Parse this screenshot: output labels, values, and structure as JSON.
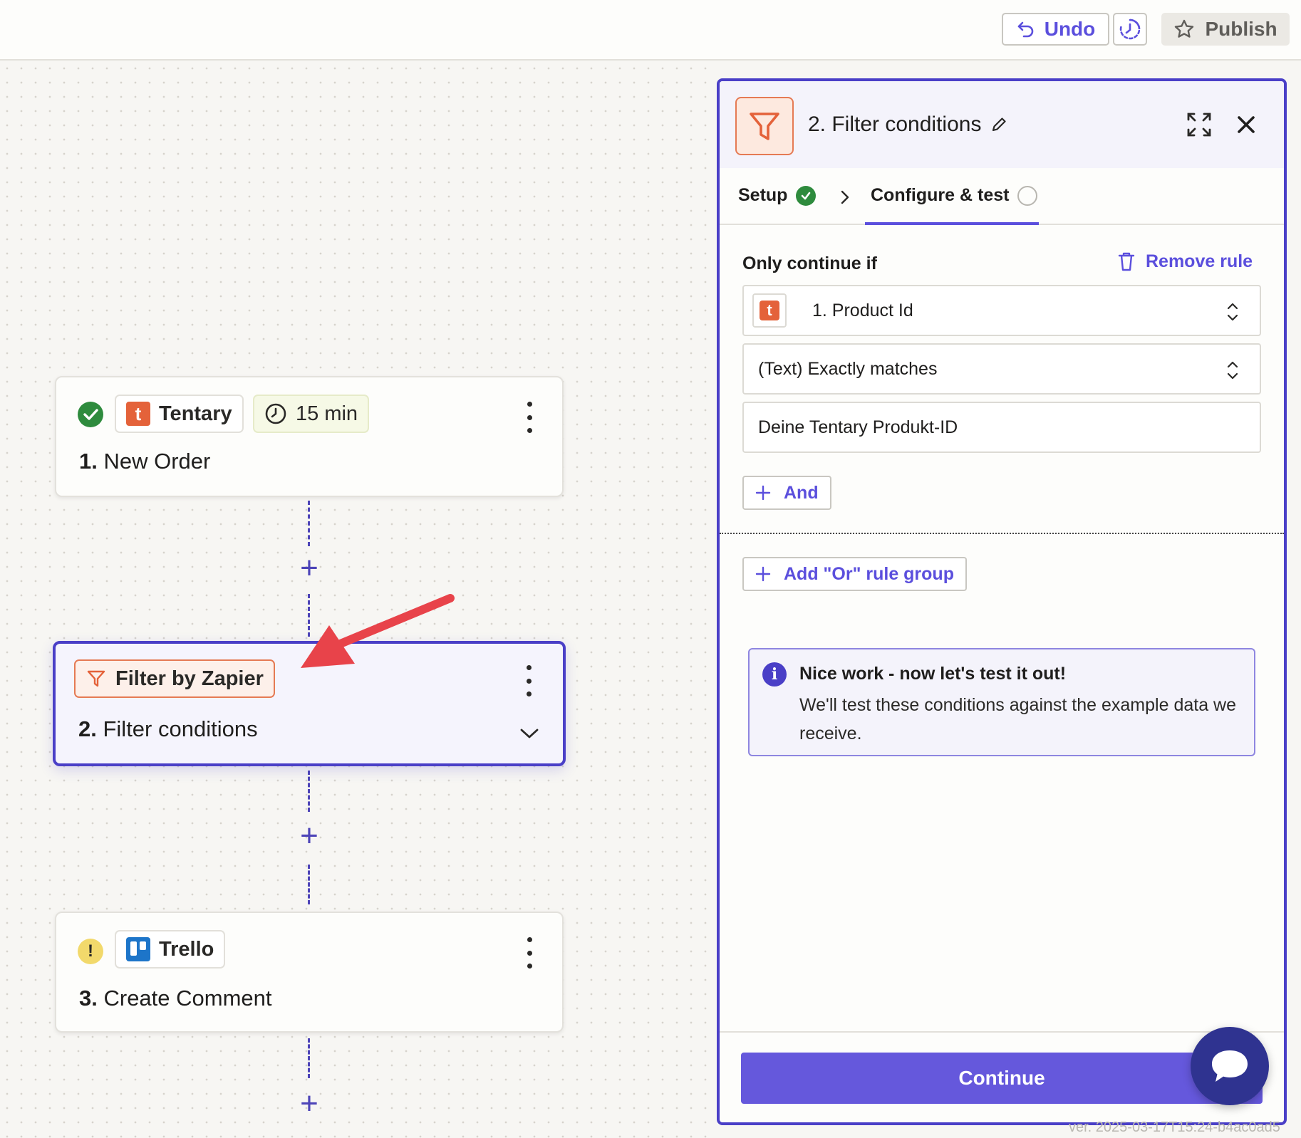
{
  "topbar": {
    "undo_label": "Undo",
    "publish_label": "Publish"
  },
  "canvas": {
    "steps": [
      {
        "app": "Tentary",
        "badge_time": "15 min",
        "number": "1.",
        "title": "New Order",
        "status": "success"
      },
      {
        "app": "Filter by Zapier",
        "number": "2.",
        "title": "Filter conditions",
        "status": "active"
      },
      {
        "app": "Trello",
        "number": "3.",
        "title": "Create Comment",
        "status": "warning",
        "status_glyph": "!"
      }
    ]
  },
  "panel": {
    "title": "2. Filter conditions",
    "tabs": [
      {
        "label": "Setup",
        "state": "complete"
      },
      {
        "label": "Configure & test",
        "state": "active"
      }
    ],
    "rule": {
      "label": "Only continue if",
      "remove_label": "Remove rule",
      "field_value": "1. Product Id",
      "condition_value": "(Text) Exactly matches",
      "match_value": "Deine Tentary Produkt-ID"
    },
    "and_label": "And",
    "or_label": "Add \"Or\" rule group",
    "info": {
      "title": "Nice work - now let's test it out!",
      "body": "We'll test these conditions against the example data we receive."
    },
    "continue_label": "Continue"
  },
  "version_text": "ver. 2025-03-17T15:24-b4ac0ad5",
  "colors": {
    "accent": "#5b4fdd",
    "active_border": "#4a3fc7",
    "success": "#2e8b3d",
    "warning": "#f2d96b",
    "tentary": "#e4623a",
    "trello": "#1d75c9",
    "filter": "#e57a54",
    "annotation_arrow": "#e8434a"
  }
}
